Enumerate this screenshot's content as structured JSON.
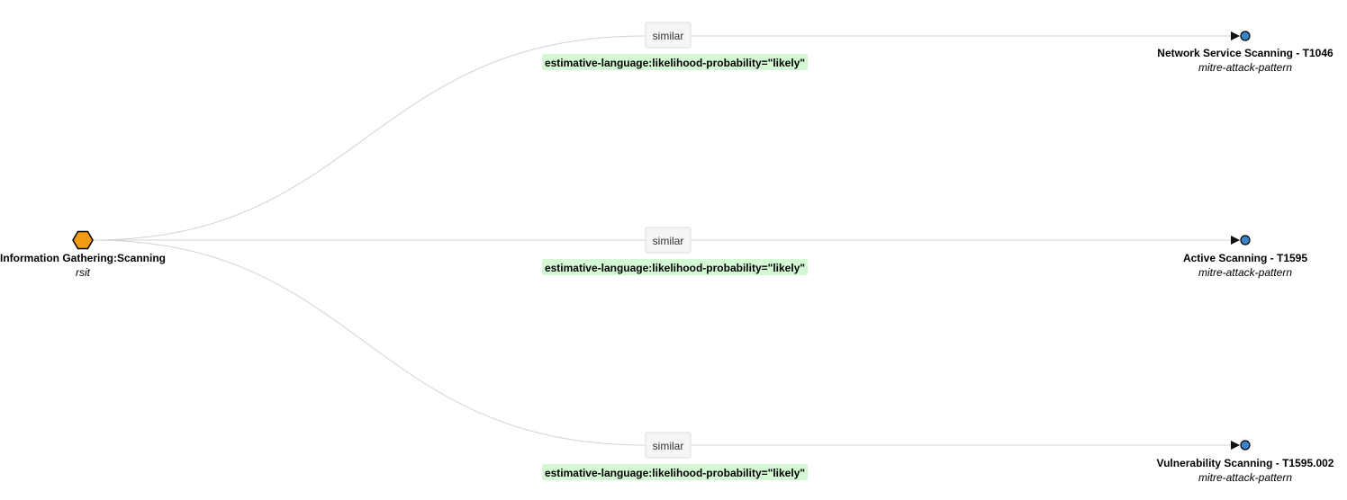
{
  "colors": {
    "source_node": "#f39c12",
    "target_node": "#3a83c9",
    "edge": "#d3d3d3",
    "tag_background": "#d4f7d4",
    "relation_box": "#f5f5f5"
  },
  "source": {
    "title": "Information Gathering:Scanning",
    "subtitle": "rsit",
    "shape": "hexagon"
  },
  "relations": [
    {
      "label": "similar",
      "tag": "estimative-language:likelihood-probability=\"likely\"",
      "target_title": "Network Service Scanning - T1046",
      "target_subtitle": "mitre-attack-pattern"
    },
    {
      "label": "similar",
      "tag": "estimative-language:likelihood-probability=\"likely\"",
      "target_title": "Active Scanning - T1595",
      "target_subtitle": "mitre-attack-pattern"
    },
    {
      "label": "similar",
      "tag": "estimative-language:likelihood-probability=\"likely\"",
      "target_title": "Vulnerability Scanning - T1595.002",
      "target_subtitle": "mitre-attack-pattern"
    }
  ]
}
